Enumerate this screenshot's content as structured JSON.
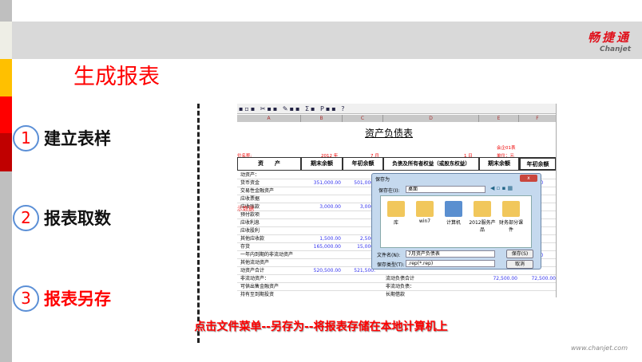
{
  "brand": {
    "cn": "畅捷通",
    "en": "Chanjet",
    "colors": {
      "red": "#e0101a",
      "yellow": "#ffc000",
      "dark_red": "#c00000",
      "band": "#d9d9d9"
    }
  },
  "title": "生成报表",
  "steps": [
    {
      "num": "1",
      "label": "建立表样",
      "active": false
    },
    {
      "num": "2",
      "label": "报表取数",
      "active": false
    },
    {
      "num": "3",
      "label": "报表另存",
      "active": true
    }
  ],
  "sheet": {
    "columns": [
      "A",
      "B",
      "C",
      "D",
      "E",
      "F"
    ],
    "report_title": "资产负债表",
    "meta": {
      "company": "位名称:",
      "year": "2012 年",
      "month": "7 月",
      "day": "1 日",
      "form": "会企01表",
      "unit": "单位：元"
    },
    "headers": [
      "资　　产",
      "期末余额",
      "年初余额",
      "负债及所有者权益（或股东权益）",
      "期末余额",
      "年初余额"
    ],
    "rows": [
      {
        "name": "动资产：",
        "b": "",
        "c": ""
      },
      {
        "name": "货币资金",
        "b": "351,000.00",
        "c": "501,000."
      },
      {
        "name": "交易性金融资产",
        "b": "",
        "c": ""
      },
      {
        "name": "应收票据",
        "b": "",
        "c": ""
      },
      {
        "name": "应收账款",
        "b": "3,000.00",
        "c": "3,000."
      },
      {
        "name": "预付款项",
        "b": "",
        "c": ""
      },
      {
        "name": "应收利息",
        "b": "",
        "c": ""
      },
      {
        "name": "应收股利",
        "b": "",
        "c": ""
      },
      {
        "name": "其他应收款",
        "b": "1,500.00",
        "c": "2,500."
      },
      {
        "name": "存货",
        "b": "165,000.00",
        "c": "15,000."
      },
      {
        "name": "一年内到期的非流动资产",
        "b": "",
        "c": ""
      },
      {
        "name": "其他流动资产",
        "b": "",
        "c": ""
      },
      {
        "name": "动资产合计",
        "b": "520,500.00",
        "c": "521,500."
      },
      {
        "name": "非流动资产：",
        "b": "",
        "c": "",
        "d": "流动负债合计",
        "e": "72,500.00",
        "f": "72,500.00"
      },
      {
        "name": "可供出售金融资产",
        "b": "",
        "c": "",
        "d": "非流动负债："
      },
      {
        "name": "持有至到期投资",
        "b": "",
        "c": "",
        "d": "长期借款"
      }
    ],
    "right_partial": [
      "0.00",
      "0.00"
    ],
    "overlay_text": "示数据"
  },
  "dialog": {
    "title": "保存为",
    "save_in_label": "保存在(I):",
    "save_in_value": "桌面",
    "files": [
      "库",
      "win7",
      "计算机",
      "2012服务产品",
      "财务部分课件"
    ],
    "filename_label": "文件名(N):",
    "filename_value": "7月资产负债表",
    "filetype_label": "保存类型(T):",
    "filetype_value": ".rep(*.rep)",
    "save_button": "保存(S)",
    "cancel_button": "取消",
    "close": "x"
  },
  "caption": "点击文件菜单--另存为--将报表存储在本地计算机上",
  "site": "www.chanjet.com"
}
